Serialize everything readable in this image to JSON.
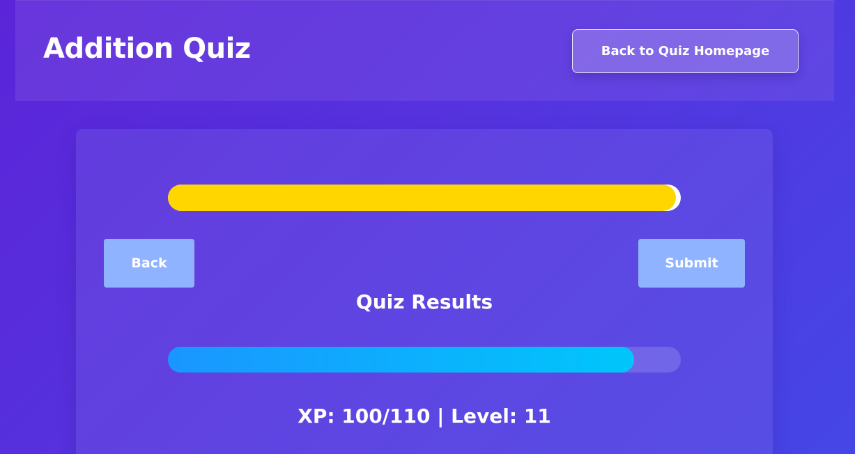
{
  "header": {
    "title": "Addition Quiz",
    "home_button_label": "Back to Quiz Homepage"
  },
  "quiz": {
    "progress_fraction": 0.99,
    "progress_color": "#ffd600",
    "back_label": "Back",
    "submit_label": "Submit",
    "button_color": "#8fb3ff"
  },
  "results": {
    "title": "Quiz Results",
    "xp": 100,
    "xp_max": 110,
    "level": 11,
    "xp_text": "XP: 100/110 | Level: 11"
  },
  "colors": {
    "background_start": "#5b24d8",
    "background_end": "#4546e6",
    "xp_bar_start": "#1a96ff",
    "xp_bar_end": "#00c6fb"
  }
}
